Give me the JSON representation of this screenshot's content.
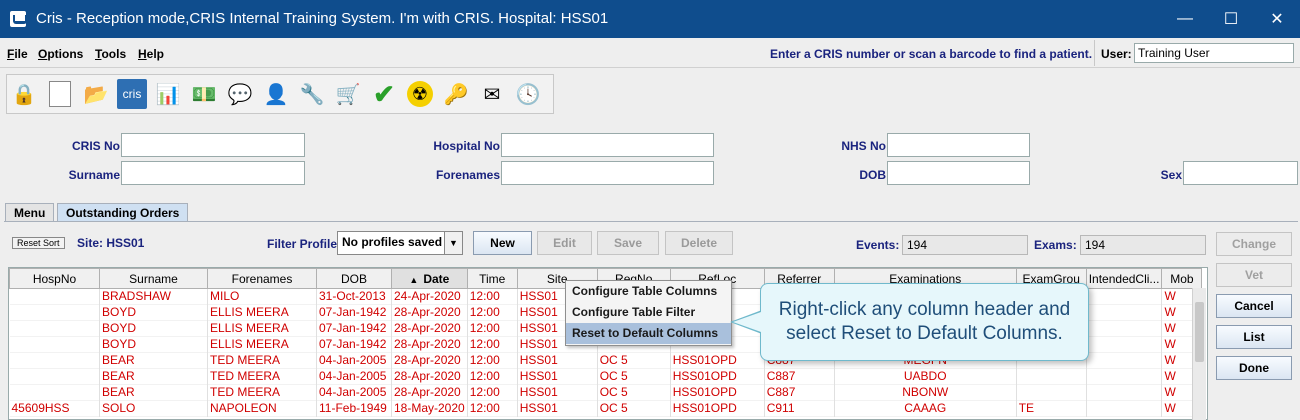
{
  "window": {
    "title": "Cris - Reception mode,CRIS Internal Training System. I'm with CRIS.   Hospital: HSS01",
    "minimize": "—",
    "maximize": "☐",
    "close": "✕"
  },
  "menubar": {
    "items": [
      {
        "underline": "F",
        "rest": "ile"
      },
      {
        "underline": "O",
        "rest": "ptions"
      },
      {
        "underline": "T",
        "rest": "ools"
      },
      {
        "underline": "H",
        "rest": "elp"
      }
    ],
    "hint": "Enter a CRIS number or scan a barcode to find a patient.",
    "user_label": "User:",
    "user_value": "Training User"
  },
  "toolbar": {
    "icons": [
      "lock-icon",
      "blank-page-icon",
      "open-folder-icon",
      "cris-icon",
      "chart-book-icon",
      "money-icon",
      "chat-icon",
      "person-info-icon",
      "wrench-icon",
      "cart-icon",
      "checkmark-icon",
      "radiation-icon",
      "key-icon",
      "envelope-icon",
      "clock-icon"
    ],
    "cris_text": "cris"
  },
  "search": {
    "cris_no": "CRIS No",
    "hospital_no": "Hospital No",
    "nhs_no": "NHS No",
    "surname": "Surname",
    "forenames": "Forenames",
    "dob": "DOB",
    "sex": "Sex"
  },
  "tabs": [
    "Menu",
    "Outstanding Orders"
  ],
  "filter": {
    "reset_sort": "Reset Sort",
    "site": "Site:  HSS01",
    "filter_profile_label": "Filter Profile",
    "filter_profile_value": "No profiles saved",
    "new": "New",
    "edit": "Edit",
    "save": "Save",
    "delete": "Delete",
    "events_label": "Events:",
    "events_value": "194",
    "exams_label": "Exams:",
    "exams_value": "194"
  },
  "table": {
    "columns": [
      "HospNo",
      "Surname",
      "Forenames",
      "DOB",
      "Date",
      "Time",
      "Site",
      "RegNo",
      "RefLoc",
      "Referrer",
      "Examinations",
      "ExamGrou",
      "IntendedCli...",
      "Mob"
    ],
    "sorted_column": "Date",
    "sort_glyph": "▲",
    "rows": [
      [
        "",
        "BRADSHAW",
        "MILO",
        "31-Oct-2013",
        "24-Apr-2020",
        "12:00",
        "HSS01",
        "",
        "",
        "",
        "",
        "",
        "",
        "W"
      ],
      [
        "",
        "BOYD",
        "ELLIS MEERA",
        "07-Jan-1942",
        "28-Apr-2020",
        "12:00",
        "HSS01",
        "",
        "",
        "",
        "",
        "",
        "",
        "W"
      ],
      [
        "",
        "BOYD",
        "ELLIS MEERA",
        "07-Jan-1942",
        "28-Apr-2020",
        "12:00",
        "HSS01",
        "",
        "",
        "",
        "",
        "",
        "",
        "W"
      ],
      [
        "",
        "BOYD",
        "ELLIS MEERA",
        "07-Jan-1942",
        "28-Apr-2020",
        "12:00",
        "HSS01",
        "",
        "",
        "",
        "",
        "",
        "",
        "W"
      ],
      [
        "",
        "BEAR",
        "TED MEERA",
        "04-Jan-2005",
        "28-Apr-2020",
        "12:00",
        "HSS01",
        "OC 5",
        "HSS01OPD",
        "C887",
        "MEGFN",
        "",
        "",
        "W"
      ],
      [
        "",
        "BEAR",
        "TED MEERA",
        "04-Jan-2005",
        "28-Apr-2020",
        "12:00",
        "HSS01",
        "OC 5",
        "HSS01OPD",
        "C887",
        "UABDO",
        "",
        "",
        "W"
      ],
      [
        "",
        "BEAR",
        "TED MEERA",
        "04-Jan-2005",
        "28-Apr-2020",
        "12:00",
        "HSS01",
        "OC 5",
        "HSS01OPD",
        "C887",
        "NBONW",
        "",
        "",
        "W"
      ],
      [
        "45609HSS",
        "SOLO",
        "NAPOLEON",
        "11-Feb-1949",
        "18-May-2020",
        "12:00",
        "HSS01",
        "OC 5",
        "HSS01OPD",
        "C911",
        "CAAAG",
        "TE",
        "",
        "W"
      ]
    ]
  },
  "side_buttons": {
    "change": "Change",
    "vet": "Vet",
    "cancel": "Cancel",
    "list": "List",
    "done": "Done"
  },
  "context_menu": {
    "items": [
      "Configure Table Columns",
      "Configure Table Filter",
      "Reset to Default Columns"
    ],
    "selected_index": 2
  },
  "callout": {
    "text": "Right-click any column header and select Reset to Default Columns."
  }
}
